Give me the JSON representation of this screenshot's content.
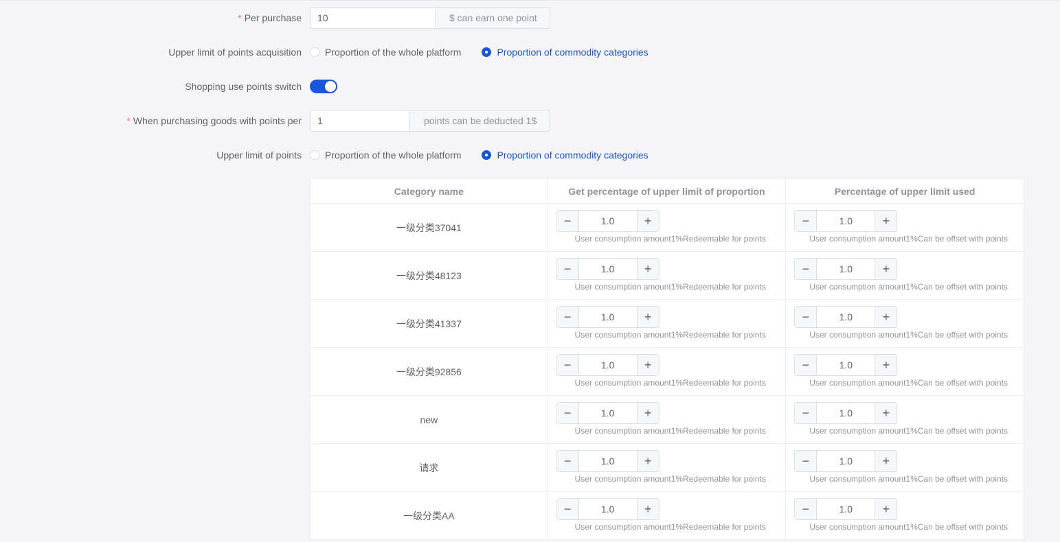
{
  "form": {
    "per_purchase": {
      "required_mark": "*",
      "label": "Per purchase",
      "value": "10",
      "append": "$ can earn one point"
    },
    "acquisition_limit": {
      "label": "Upper limit of points acquisition",
      "options": [
        "Proportion of the whole platform",
        "Proportion of commodity categories"
      ],
      "selected": "Proportion of commodity categories"
    },
    "shopping_switch": {
      "label": "Shopping use points switch",
      "on": true
    },
    "deduct": {
      "required_mark": "*",
      "label": "When purchasing goods with points per",
      "value": "1",
      "append": "points can be deducted 1$"
    },
    "points_limit": {
      "label": "Upper limit of points",
      "options": [
        "Proportion of the whole platform",
        "Proportion of commodity categories"
      ],
      "selected": "Proportion of commodity categories"
    }
  },
  "table": {
    "headers": [
      "Category name",
      "Get percentage of upper limit of proportion",
      "Percentage of upper limit used"
    ],
    "minus_symbol": "−",
    "plus_symbol": "+",
    "rows": [
      {
        "name": "一级分类37041",
        "get": "1.0",
        "get_hint": "User consumption amount1%Redeemable for points",
        "use": "1.0",
        "use_hint": "User consumption amount1%Can be offset with points"
      },
      {
        "name": "一级分类48123",
        "get": "1.0",
        "get_hint": "User consumption amount1%Redeemable for points",
        "use": "1.0",
        "use_hint": "User consumption amount1%Can be offset with points"
      },
      {
        "name": "一级分类41337",
        "get": "1.0",
        "get_hint": "User consumption amount1%Redeemable for points",
        "use": "1.0",
        "use_hint": "User consumption amount1%Can be offset with points"
      },
      {
        "name": "一级分类92856",
        "get": "1.0",
        "get_hint": "User consumption amount1%Redeemable for points",
        "use": "1.0",
        "use_hint": "User consumption amount1%Can be offset with points"
      },
      {
        "name": "new",
        "get": "1.0",
        "get_hint": "User consumption amount1%Redeemable for points",
        "use": "1.0",
        "use_hint": "User consumption amount1%Can be offset with points"
      },
      {
        "name": "请求",
        "get": "1.0",
        "get_hint": "User consumption amount1%Redeemable for points",
        "use": "1.0",
        "use_hint": "User consumption amount1%Can be offset with points"
      },
      {
        "name": "一级分类AA",
        "get": "1.0",
        "get_hint": "User consumption amount1%Redeemable for points",
        "use": "1.0",
        "use_hint": "User consumption amount1%Can be offset with points"
      }
    ]
  },
  "colors": {
    "accent": "#1a56db",
    "required": "#f56c6c",
    "background": "#f5f5f7"
  }
}
